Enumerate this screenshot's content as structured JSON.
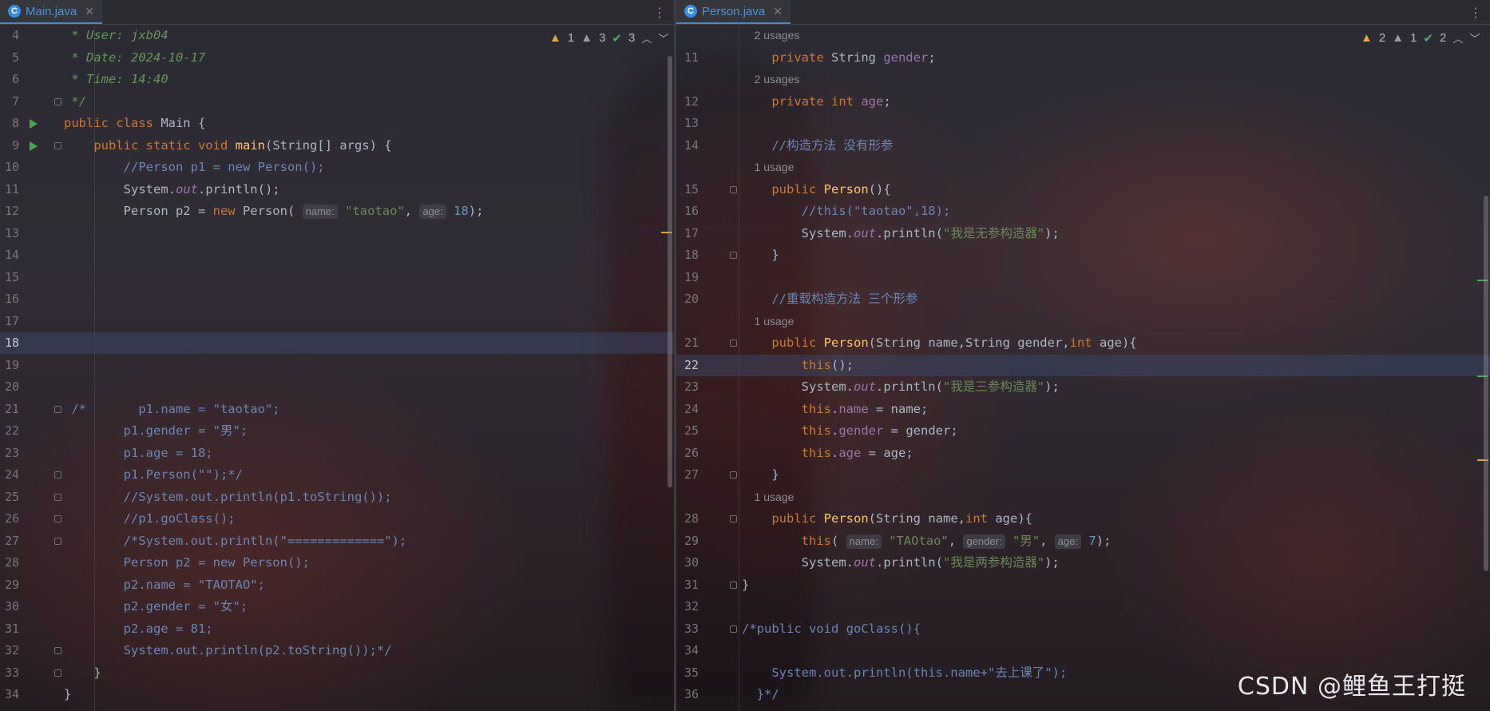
{
  "left": {
    "tab": {
      "icon": "C",
      "label": "Main.java"
    },
    "inspections": {
      "warnings": "1",
      "weak_warnings": "3",
      "ok": "3"
    },
    "lines": [
      {
        "n": "4",
        "html": "<span class=\"dc\"> * User: jxb04</span>"
      },
      {
        "n": "5",
        "html": "<span class=\"dc\"> * Date: 2024-10-17</span>"
      },
      {
        "n": "6",
        "html": "<span class=\"dc\"> * Time: 14:40</span>"
      },
      {
        "n": "7",
        "html": "<span class=\"dc\"> */</span>",
        "fold": true
      },
      {
        "n": "8",
        "html": "<span class=\"kw\">public class</span> Main {",
        "run": true
      },
      {
        "n": "9",
        "html": "    <span class=\"kw\">public static void</span> <span class=\"mth\">main</span>(String[] args) {",
        "run": true,
        "fold": true
      },
      {
        "n": "10",
        "html": "        <span class=\"cmt\">//Person p1 = new Person();</span>"
      },
      {
        "n": "11",
        "html": "        System.<span class=\"ital\">out</span>.println();"
      },
      {
        "n": "12",
        "html": "        Person p2 = <span class=\"kw\">new</span> Person( <span class=\"hint\">name:</span> <span class=\"str\">\"taotao\"</span>, <span class=\"hint\">age:</span> <span class=\"num\">18</span>);"
      },
      {
        "n": "13",
        "html": ""
      },
      {
        "n": "14",
        "html": ""
      },
      {
        "n": "15",
        "html": ""
      },
      {
        "n": "16",
        "html": ""
      },
      {
        "n": "17",
        "html": ""
      },
      {
        "n": "18",
        "html": "",
        "current": true
      },
      {
        "n": "19",
        "html": ""
      },
      {
        "n": "20",
        "html": ""
      },
      {
        "n": "21",
        "html": "<span class=\"cmt\"> /*       p1.name = \"taotao\";</span>",
        "fold": true
      },
      {
        "n": "22",
        "html": "<span class=\"cmt\">        p1.gender = \"男\";</span>"
      },
      {
        "n": "23",
        "html": "<span class=\"cmt\">        p1.age = 18;</span>"
      },
      {
        "n": "24",
        "html": "<span class=\"cmt\">        p1.Person(\"\");*/</span>",
        "fold": true
      },
      {
        "n": "25",
        "html": "<span class=\"cmt\">        //System.out.println(p1.toString());</span>",
        "fold": true
      },
      {
        "n": "26",
        "html": "<span class=\"cmt\">        //p1.goClass();</span>",
        "fold": true
      },
      {
        "n": "27",
        "html": "<span class=\"cmt\">        /*System.out.println(\"=============\");</span>",
        "fold": true
      },
      {
        "n": "28",
        "html": "<span class=\"cmt\">        Person p2 = new Person();</span>"
      },
      {
        "n": "29",
        "html": "<span class=\"cmt\">        p2.name = \"TAOTAO\";</span>"
      },
      {
        "n": "30",
        "html": "<span class=\"cmt\">        p2.gender = \"女\";</span>"
      },
      {
        "n": "31",
        "html": "<span class=\"cmt\">        p2.age = 81;</span>"
      },
      {
        "n": "32",
        "html": "<span class=\"cmt\">        System.out.println(p2.toString());*/</span>",
        "fold": true
      },
      {
        "n": "33",
        "html": "    }",
        "fold": true
      },
      {
        "n": "34",
        "html": "}"
      }
    ]
  },
  "right": {
    "tab": {
      "icon": "C",
      "label": "Person.java"
    },
    "inspections": {
      "warnings": "2",
      "weak_warnings": "1",
      "ok": "2"
    },
    "lines": [
      {
        "n": "",
        "html": "<span class=\"usage\">    2 usages</span>"
      },
      {
        "n": "11",
        "html": "    <span class=\"kw\">private</span> String <span class=\"fld\">gender</span>;"
      },
      {
        "n": "",
        "html": "<span class=\"usage\">    2 usages</span>"
      },
      {
        "n": "12",
        "html": "    <span class=\"kw\">private int</span> <span class=\"fld\">age</span>;"
      },
      {
        "n": "13",
        "html": ""
      },
      {
        "n": "14",
        "html": "    <span class=\"cmt\">//构造方法 没有形参</span>"
      },
      {
        "n": "",
        "html": "<span class=\"usage\">    1 usage</span>"
      },
      {
        "n": "15",
        "html": "    <span class=\"kw\">public</span> <span class=\"mth\">Person</span>(){",
        "fold": true
      },
      {
        "n": "16",
        "html": "        <span class=\"cmt\">//this(\"taotao\",18);</span>"
      },
      {
        "n": "17",
        "html": "        System.<span class=\"ital\">out</span>.println(<span class=\"str\">\"我是无参构造器\"</span>);"
      },
      {
        "n": "18",
        "html": "    }",
        "fold": true
      },
      {
        "n": "19",
        "html": ""
      },
      {
        "n": "20",
        "html": "    <span class=\"cmt\">//重载构造方法 三个形参</span>"
      },
      {
        "n": "",
        "html": "<span class=\"usage\">    1 usage</span>"
      },
      {
        "n": "21",
        "html": "    <span class=\"kw\">public</span> <span class=\"mth\">Person</span>(String name,String gender,<span class=\"kw\">int</span> age){",
        "fold": true
      },
      {
        "n": "22",
        "html": "        <span class=\"kw\">this</span>();",
        "current": true
      },
      {
        "n": "23",
        "html": "        System.<span class=\"ital\">out</span>.println(<span class=\"str\">\"我是三参构造器\"</span>);"
      },
      {
        "n": "24",
        "html": "        <span class=\"kw\">this</span>.<span class=\"fld\">name</span> = name;"
      },
      {
        "n": "25",
        "html": "        <span class=\"kw\">this</span>.<span class=\"fld\">gender</span> = gender;"
      },
      {
        "n": "26",
        "html": "        <span class=\"kw\">this</span>.<span class=\"fld\">age</span> = age;"
      },
      {
        "n": "27",
        "html": "    }",
        "fold": true
      },
      {
        "n": "",
        "html": "<span class=\"usage\">    1 usage</span>"
      },
      {
        "n": "28",
        "html": "    <span class=\"kw\">public</span> <span class=\"mth\">Person</span>(String name,<span class=\"kw\">int</span> age){",
        "fold": true
      },
      {
        "n": "29",
        "html": "        <span class=\"kw\">this</span>( <span class=\"hint\">name:</span> <span class=\"str\">\"TAOtao\"</span>, <span class=\"hint\">gender:</span> <span class=\"str\">\"男\"</span>, <span class=\"hint\">age:</span> <span class=\"num\">7</span>);"
      },
      {
        "n": "30",
        "html": "        System.<span class=\"ital\">out</span>.println(<span class=\"str\">\"我是两参构造器\"</span>);"
      },
      {
        "n": "31",
        "html": "}",
        "fold": true
      },
      {
        "n": "32",
        "html": ""
      },
      {
        "n": "33",
        "html": "<span class=\"cmt\">/*public void goClass(){</span>",
        "fold": true
      },
      {
        "n": "34",
        "html": ""
      },
      {
        "n": "35",
        "html": "<span class=\"cmt\">    System.out.println(this.name+\"去上课了\");</span>"
      },
      {
        "n": "36",
        "html": "<span class=\"cmt\">  }*/</span>"
      }
    ]
  },
  "watermark": "CSDN @鲤鱼王打挺",
  "kebab_icon": "⋮",
  "colors": {
    "accent": "#4a88c7",
    "keyword": "#cc7832",
    "string": "#6a8759",
    "number": "#6897bb",
    "field": "#9876aa",
    "method": "#ffc66d"
  }
}
